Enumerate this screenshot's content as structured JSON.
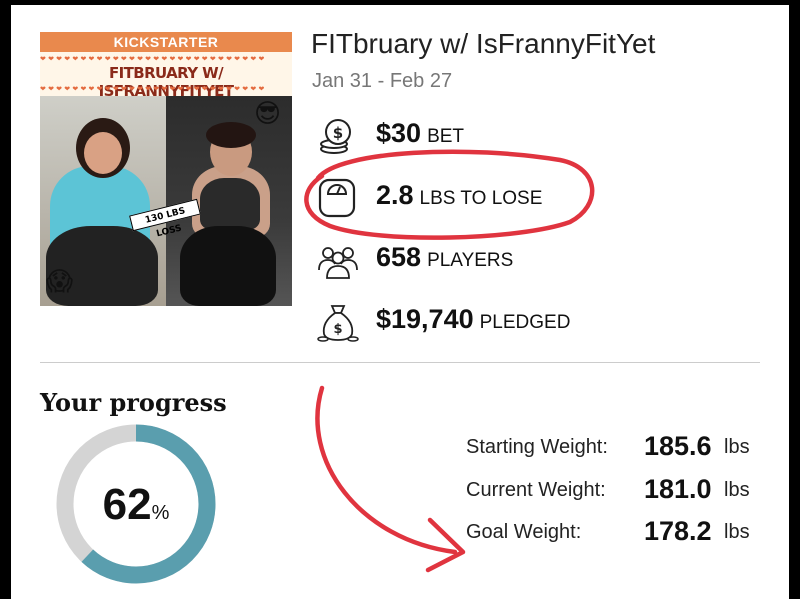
{
  "challenge": {
    "banner": "KICKSTARTER",
    "image_title": "FITBRUARY W/ ISFRANNYFITYET",
    "loss_tag": "130 LBS LOSS",
    "title": "FITbruary w/ IsFrannyFitYet",
    "dates": "Jan 31 - Feb 27"
  },
  "stats": {
    "bet": {
      "value": "$30",
      "unit": "BET",
      "icon": "coins-icon"
    },
    "to_lose": {
      "value": "2.8",
      "unit": "LBS TO LOSE",
      "icon": "scale-icon"
    },
    "players": {
      "value": "658",
      "unit": "PLAYERS",
      "icon": "people-icon"
    },
    "pledged": {
      "value": "$19,740",
      "unit": "PLEDGED",
      "icon": "money-bag-icon"
    }
  },
  "progress": {
    "title": "Your progress",
    "percent_value": 62,
    "percent_text": "62",
    "percent_symbol": "%",
    "ring_color": "#5a9eae",
    "track_color": "#d4d4d4"
  },
  "weights": {
    "starting": {
      "label": "Starting Weight:",
      "value": "185.6",
      "unit": "lbs"
    },
    "current": {
      "label": "Current Weight:",
      "value": "181.0",
      "unit": "lbs"
    },
    "goal": {
      "label": "Goal Weight:",
      "value": "178.2",
      "unit": "lbs"
    }
  },
  "annotation_color": "#e0343f"
}
